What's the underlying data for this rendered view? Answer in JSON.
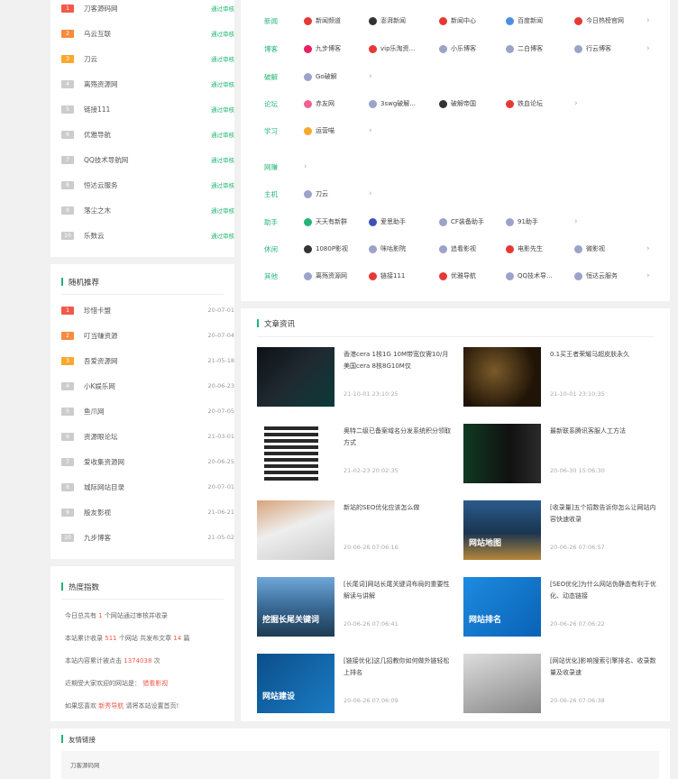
{
  "top_rank": [
    {
      "num": "1",
      "name": "刀客源码网",
      "status": "通过审核"
    },
    {
      "num": "2",
      "name": "乌云互联",
      "status": "通过审核"
    },
    {
      "num": "3",
      "name": "刀云",
      "status": "通过审核"
    },
    {
      "num": "4",
      "name": "离殇资源网",
      "status": "通过审核"
    },
    {
      "num": "5",
      "name": "链接111",
      "status": "通过审核"
    },
    {
      "num": "6",
      "name": "优雅导航",
      "status": "通过审核"
    },
    {
      "num": "7",
      "name": "QQ技术导航网",
      "status": "通过审核"
    },
    {
      "num": "8",
      "name": "恒达云服务",
      "status": "通过审核"
    },
    {
      "num": "9",
      "name": "落尘之木",
      "status": "通过审核"
    },
    {
      "num": "10",
      "name": "乐数云",
      "status": "通过审核"
    }
  ],
  "random": {
    "title": "随机推荐",
    "items": [
      {
        "num": "1",
        "name": "珍惜卡盟",
        "date": "20-07-01"
      },
      {
        "num": "2",
        "name": "叮当赚资源",
        "date": "20-07-04"
      },
      {
        "num": "3",
        "name": "吾爱资源网",
        "date": "21-05-18"
      },
      {
        "num": "4",
        "name": "小K娱乐网",
        "date": "20-06-23"
      },
      {
        "num": "5",
        "name": "鱼爪网",
        "date": "20-07-05"
      },
      {
        "num": "6",
        "name": "资源眼论坛",
        "date": "21-03-01"
      },
      {
        "num": "7",
        "name": "爱收集资源网",
        "date": "20-06-25"
      },
      {
        "num": "8",
        "name": "城际网站目录",
        "date": "20-07-01"
      },
      {
        "num": "9",
        "name": "殷友影视",
        "date": "21-06-21"
      },
      {
        "num": "10",
        "name": "九步博客",
        "date": "21-05-02"
      }
    ]
  },
  "heat": {
    "title": "热度指数",
    "l1a": "今日总共有",
    "l1b": "1",
    "l1c": "个网站通过审核并收录",
    "l2a": "本站累计收录",
    "l2b": "511",
    "l2c": "个网站 共发布文章",
    "l2d": "14",
    "l2e": "篇",
    "l3a": "本站内容累计被点击",
    "l3b": "1374038",
    "l3c": "次",
    "l4a": "近期受大家欢迎的网站是：",
    "l4b": "猎看影视",
    "l5a": "如果您喜欢",
    "l5b": "新秀导航",
    "l5c": "请将本站设置首页!"
  },
  "categories": [
    {
      "cat": "新闻",
      "items": [
        "新闻频道",
        "澎湃新闻",
        "新闻中心",
        "百度新闻",
        "今日热榜官网"
      ],
      "colors": [
        "#e53935",
        "#333333",
        "#e53935",
        "#4a90e2",
        "#e53935"
      ]
    },
    {
      "cat": "博客",
      "items": [
        "九步博客",
        "vip乐淘资...",
        "小乐博客",
        "二白博客",
        "行云博客"
      ],
      "colors": [
        "#e91e63",
        "#e53935",
        "#9aa3c8",
        "#9aa3c8",
        "#9aa3c8"
      ]
    },
    {
      "cat": "破解",
      "items": [
        "Go破解"
      ],
      "colors": [
        "#9aa3c8"
      ]
    },
    {
      "cat": "论坛",
      "items": [
        "赤友网",
        "3swg破解...",
        "破解帝国",
        "铁血论坛"
      ],
      "colors": [
        "#f06292",
        "#9aa3c8",
        "#333333",
        "#e53935"
      ]
    },
    {
      "cat": "学习",
      "items": [
        "运营喵"
      ],
      "colors": [
        "#f8a82b"
      ]
    },
    {
      "cat": "网赚",
      "items": [],
      "colors": []
    },
    {
      "cat": "主机",
      "items": [
        "刀云"
      ],
      "colors": [
        "#9aa3c8"
      ]
    },
    {
      "cat": "助手",
      "items": [
        "天天有新群",
        "爱思助手",
        "CF装备助手",
        "91助手"
      ],
      "colors": [
        "#22b573",
        "#3f51b5",
        "#9aa3c8",
        "#9aa3c8"
      ]
    },
    {
      "cat": "休闲",
      "items": [
        "1080P影视",
        "咪咕影院",
        "追看影视",
        "电影先生",
        "微影视"
      ],
      "colors": [
        "#333333",
        "#9aa3c8",
        "#9aa3c8",
        "#e53935",
        "#9aa3c8"
      ]
    },
    {
      "cat": "其他",
      "items": [
        "离殇资源网",
        "链接111",
        "优雅导航",
        "QQ技术导...",
        "恒达云服务"
      ],
      "colors": [
        "#9aa3c8",
        "#e53935",
        "#e53935",
        "#9aa3c8",
        "#9aa3c8"
      ]
    }
  ],
  "articles": {
    "title": "文章资讯",
    "items": [
      {
        "title": "香港cera 1核1G 10M带宽仅需10/月 美国cera 8核8G10M仅",
        "time": "21-10-01 23:10:25"
      },
      {
        "title": "0.1买王者荣耀马超皮肤永久",
        "time": "21-10-01 23:10:35"
      },
      {
        "title": "奥特二级已备案域名分发系统积分领取方式",
        "time": "21-02-23 20:02:35"
      },
      {
        "title": "最新联系腾讯客服人工方法",
        "time": "20-06-30 15:06:30"
      },
      {
        "title": "新站的SEO优化应该怎么做",
        "time": "20-06-26 07:06:16"
      },
      {
        "title": "[收录量]五个招数告诉你怎么让网站内容快速收录",
        "time": "20-06-26 07:06:57"
      },
      {
        "title": "[长尾词]网站长尾关键词布局的重要性解读与讲解",
        "time": "20-06-26 07:06:41"
      },
      {
        "title": "[SEO优化]为什么网站伪静态有利于优化、动态链接",
        "time": "20-06-26 07:06:22"
      },
      {
        "title": "[链接优化]这几招教你如何做外链轻松上排名",
        "time": "20-06-26 07:06:09"
      },
      {
        "title": "[网站优化]影响搜索引擎排名、收录数量及收录速",
        "time": "20-06-26 07:06:38"
      }
    ]
  },
  "thumbs": [
    "",
    "",
    "",
    "",
    "",
    "网站地图",
    "挖掘长尾关键词",
    "网站排名",
    "网站建设",
    ""
  ],
  "links": {
    "title": "友情链接",
    "first": "刀客源码网"
  },
  "colors": {
    "accent": "#22b573",
    "red": "#f15a4a",
    "orange": "#f78a3d",
    "yellow": "#f8a82b",
    "gray": "#cccccc"
  }
}
